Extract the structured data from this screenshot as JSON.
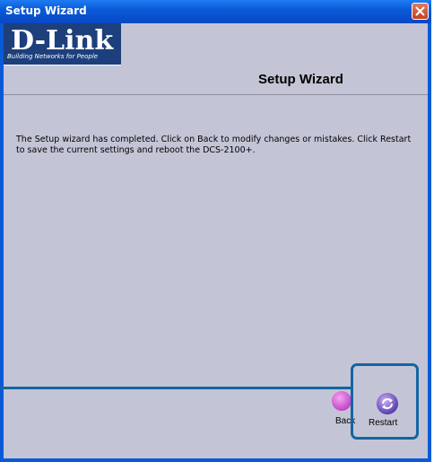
{
  "window": {
    "title": "Setup Wizard"
  },
  "brand": {
    "logo": "D-Link",
    "tagline": "Building Networks for People"
  },
  "page": {
    "title": "Setup Wizard",
    "message": "The Setup wizard has completed. Click on Back to modify changes or mistakes. Click Restart to save the current settings and reboot the DCS-2100+."
  },
  "buttons": {
    "back": "Back",
    "restart": "Restart"
  },
  "colors": {
    "titlebar": "#0a5ad8",
    "client_bg": "#c3c5d6",
    "logo_bg": "#1d3f7c",
    "callout": "#1565a0"
  }
}
